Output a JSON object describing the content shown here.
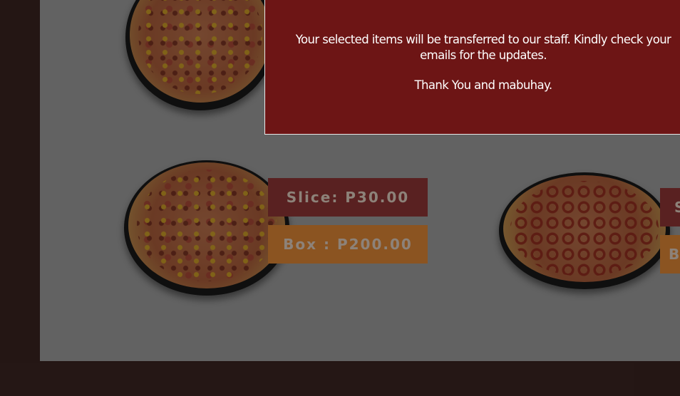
{
  "menu": {
    "items": [
      {
        "name": "hawaiian-pizza",
        "slice_label": "",
        "box_label": ""
      },
      {
        "name": "supreme-pizza",
        "slice_label": "Slice: P30.00",
        "box_label": "Box : P200.00"
      },
      {
        "name": "pepperoni-pizza",
        "slice_label": "S",
        "box_label": "B"
      }
    ]
  },
  "modal": {
    "message": "Your selected items will be transferred to our staff. Kindly check your emails for the updates.",
    "thanks": "Thank You and mabuhay."
  },
  "colors": {
    "frame": "#3f2724",
    "modal_bg": "#6d1515",
    "slice_tag": "#9a3a3a",
    "box_tag": "#f0923a"
  }
}
